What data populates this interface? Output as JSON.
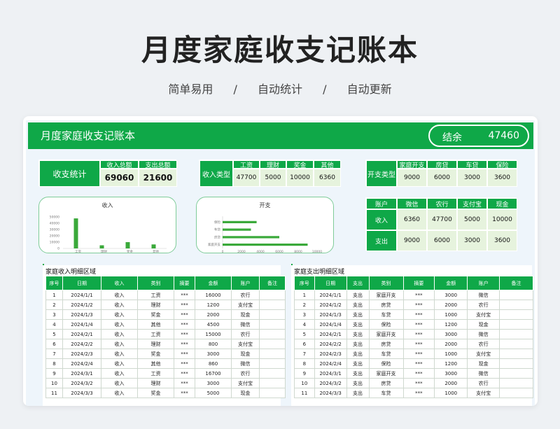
{
  "hero": {
    "title": "月度家庭收支记账本",
    "sub": [
      "简单易用",
      "/",
      "自动统计",
      "/",
      "自动更新"
    ]
  },
  "header": {
    "title": "月度家庭收支记账本",
    "balance_label": "结余",
    "balance_value": "47460"
  },
  "summary": {
    "label": "收支统计",
    "income_total_label": "收入总额",
    "expense_total_label": "支出总额",
    "income_total": "69060",
    "expense_total": "21600"
  },
  "income_types": {
    "label": "收入类型",
    "items": [
      {
        "name": "工资",
        "value": "47700"
      },
      {
        "name": "理财",
        "value": "5000"
      },
      {
        "name": "奖金",
        "value": "10000"
      },
      {
        "name": "其他",
        "value": "6360"
      }
    ]
  },
  "expense_types": {
    "label": "开支类型",
    "items": [
      {
        "name": "家庭开支",
        "value": "9000"
      },
      {
        "name": "房贷",
        "value": "6000"
      },
      {
        "name": "车贷",
        "value": "3000"
      },
      {
        "name": "保险",
        "value": "3600"
      }
    ]
  },
  "accounts": {
    "corner": "账户",
    "columns": [
      "微信",
      "农行",
      "支付宝",
      "现金"
    ],
    "rows": [
      {
        "label": "收入",
        "values": [
          "6360",
          "47700",
          "5000",
          "10000"
        ]
      },
      {
        "label": "支出",
        "values": [
          "9000",
          "6000",
          "3000",
          "3600"
        ]
      }
    ]
  },
  "chart_data": [
    {
      "type": "bar",
      "title": "收入",
      "categories": [
        "工资",
        "理财",
        "奖金",
        "其他"
      ],
      "values": [
        47700,
        5000,
        10000,
        6360
      ],
      "ylim": [
        0,
        50000
      ],
      "yticks": [
        "50000",
        "40000",
        "30000",
        "20000",
        "10000",
        "0"
      ],
      "xtick_labels": [
        "工资",
        "理财",
        "奖金",
        "其他"
      ],
      "grid": false
    },
    {
      "type": "bar",
      "orientation": "horizontal",
      "title": "开支",
      "categories": [
        "保险",
        "车贷",
        "房贷",
        "家庭开支"
      ],
      "values": [
        3600,
        3000,
        6000,
        9000
      ],
      "xlim": [
        0,
        10000
      ],
      "xticks": [
        "0",
        "2000",
        "4000",
        "6000",
        "8000",
        "10000"
      ],
      "ytick_labels": [
        "保险",
        "车贷",
        "房贷",
        "家庭开支"
      ],
      "grid": false
    }
  ],
  "income_detail": {
    "title": "家庭收入明细区域",
    "columns": [
      "序号",
      "日期",
      "收入",
      "类别",
      "摘要",
      "金额",
      "账户",
      "备注"
    ],
    "rows": [
      [
        "1",
        "2024/1/1",
        "收入",
        "工资",
        "***",
        "16000",
        "农行",
        ""
      ],
      [
        "2",
        "2024/1/2",
        "收入",
        "理财",
        "***",
        "1200",
        "支付宝",
        ""
      ],
      [
        "3",
        "2024/1/3",
        "收入",
        "奖金",
        "***",
        "2000",
        "现金",
        ""
      ],
      [
        "4",
        "2024/1/4",
        "收入",
        "其他",
        "***",
        "4500",
        "微信",
        ""
      ],
      [
        "5",
        "2024/2/1",
        "收入",
        "工资",
        "***",
        "15000",
        "农行",
        ""
      ],
      [
        "6",
        "2024/2/2",
        "收入",
        "理财",
        "***",
        "800",
        "支付宝",
        ""
      ],
      [
        "7",
        "2024/2/3",
        "收入",
        "奖金",
        "***",
        "3000",
        "现金",
        ""
      ],
      [
        "8",
        "2024/2/4",
        "收入",
        "其他",
        "***",
        "860",
        "微信",
        ""
      ],
      [
        "9",
        "2024/3/1",
        "收入",
        "工资",
        "***",
        "16700",
        "农行",
        ""
      ],
      [
        "10",
        "2024/3/2",
        "收入",
        "理财",
        "***",
        "3000",
        "支付宝",
        ""
      ],
      [
        "11",
        "2024/3/3",
        "收入",
        "奖金",
        "***",
        "5000",
        "现金",
        ""
      ]
    ]
  },
  "expense_detail": {
    "title": "家庭支出明细区域",
    "columns": [
      "序号",
      "日期",
      "支出",
      "类别",
      "摘要",
      "金额",
      "账户",
      "备注"
    ],
    "rows": [
      [
        "1",
        "2024/1/1",
        "支出",
        "家庭开支",
        "***",
        "3000",
        "微信",
        ""
      ],
      [
        "2",
        "2024/1/2",
        "支出",
        "房贷",
        "***",
        "2000",
        "农行",
        ""
      ],
      [
        "3",
        "2024/1/3",
        "支出",
        "车贷",
        "***",
        "1000",
        "支付宝",
        ""
      ],
      [
        "4",
        "2024/1/4",
        "支出",
        "保险",
        "***",
        "1200",
        "现金",
        ""
      ],
      [
        "5",
        "2024/2/1",
        "支出",
        "家庭开支",
        "***",
        "3000",
        "微信",
        ""
      ],
      [
        "6",
        "2024/2/2",
        "支出",
        "房贷",
        "***",
        "2000",
        "农行",
        ""
      ],
      [
        "7",
        "2024/2/3",
        "支出",
        "车贷",
        "***",
        "1000",
        "支付宝",
        ""
      ],
      [
        "8",
        "2024/2/4",
        "支出",
        "保险",
        "***",
        "1200",
        "现金",
        ""
      ],
      [
        "9",
        "2024/3/1",
        "支出",
        "家庭开支",
        "***",
        "3000",
        "微信",
        ""
      ],
      [
        "10",
        "2024/3/2",
        "支出",
        "房贷",
        "***",
        "2000",
        "农行",
        ""
      ],
      [
        "11",
        "2024/3/3",
        "支出",
        "车贷",
        "***",
        "1000",
        "支付宝",
        ""
      ]
    ]
  }
}
